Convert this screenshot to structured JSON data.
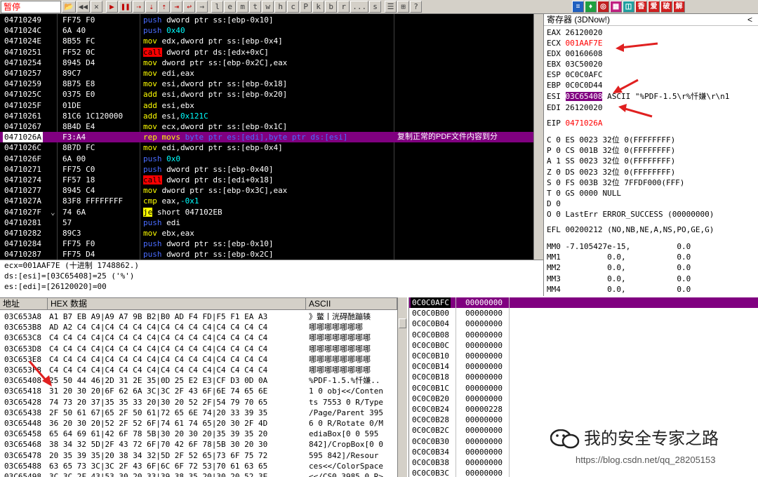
{
  "toolbar": {
    "status": "暂停",
    "buttons": [
      "📂",
      "◀◀",
      "✕",
      "▶",
      "❚❚",
      "⇢",
      "⇣",
      "⇡",
      "⇥",
      "↩",
      "→",
      "l",
      "e",
      "m",
      "t",
      "w",
      "h",
      "c",
      "P",
      "k",
      "b",
      "r",
      "...",
      "s",
      "☰",
      "⊞",
      "?"
    ],
    "right_buttons": [
      "≡",
      "♦",
      "◎",
      "▦",
      "◫",
      "香",
      "爱",
      "破",
      "解"
    ]
  },
  "cpu": {
    "rows": [
      {
        "addr": "04710249",
        "hex": "FF75 F0",
        "asm": [
          [
            "kw",
            "push "
          ],
          [
            "arg",
            "dword ptr ss:[ebp-0x10]"
          ]
        ],
        "cmt": ""
      },
      {
        "addr": "0471024C",
        "hex": "6A 40",
        "asm": [
          [
            "kw",
            "push "
          ],
          [
            "num",
            "0x40"
          ]
        ],
        "cmt": ""
      },
      {
        "addr": "0471024E",
        "hex": "8B55 FC",
        "asm": [
          [
            "mem",
            "mov "
          ],
          [
            "arg",
            "edx,dword ptr ss:[ebp-0x4]"
          ]
        ],
        "cmt": ""
      },
      {
        "addr": "04710251",
        "hex": "FF52 0C",
        "asm": [
          [
            "callhl",
            "call"
          ],
          [
            "arg",
            " dword ptr ds:[edx+0xC]"
          ]
        ],
        "cmt": ""
      },
      {
        "addr": "04710254",
        "hex": "8945 D4",
        "asm": [
          [
            "mem",
            "mov "
          ],
          [
            "arg",
            "dword ptr ss:[ebp-0x2C],eax"
          ]
        ],
        "cmt": ""
      },
      {
        "addr": "04710257",
        "hex": "89C7",
        "asm": [
          [
            "mem",
            "mov "
          ],
          [
            "arg",
            "edi,eax"
          ]
        ],
        "cmt": ""
      },
      {
        "addr": "04710259",
        "hex": "8B75 E8",
        "asm": [
          [
            "mem",
            "mov "
          ],
          [
            "arg",
            "esi,dword ptr ss:[ebp-0x18]"
          ]
        ],
        "cmt": ""
      },
      {
        "addr": "0471025C",
        "hex": "0375 E0",
        "asm": [
          [
            "mem",
            "add "
          ],
          [
            "arg",
            "esi,dword ptr ss:[ebp-0x20]"
          ]
        ],
        "cmt": ""
      },
      {
        "addr": "0471025F",
        "hex": "01DE",
        "asm": [
          [
            "mem",
            "add "
          ],
          [
            "arg",
            "esi,ebx"
          ]
        ],
        "cmt": ""
      },
      {
        "addr": "04710261",
        "hex": "81C6 1C120000",
        "asm": [
          [
            "mem",
            "add "
          ],
          [
            "arg",
            "esi,"
          ],
          [
            "num",
            "0x121C"
          ]
        ],
        "cmt": ""
      },
      {
        "addr": "04710267",
        "hex": "8B4D E4",
        "asm": [
          [
            "mem",
            "mov "
          ],
          [
            "arg",
            "ecx,dword ptr ss:[ebp-0x1C]"
          ]
        ],
        "cmt": ""
      },
      {
        "addr": "0471026A",
        "hex": "F3:A4",
        "asm": [
          [
            "mem",
            "rep movs "
          ],
          [
            "kw",
            "byte ptr es:[edi],byte ptr ds:[esi]"
          ]
        ],
        "cmt": "复制正常的PDF文件内容到分",
        "sel": true
      },
      {
        "addr": "0471026C",
        "hex": "8B7D FC",
        "asm": [
          [
            "mem",
            "mov "
          ],
          [
            "arg",
            "edi,dword ptr ss:[ebp-0x4]"
          ]
        ],
        "cmt": ""
      },
      {
        "addr": "0471026F",
        "hex": "6A 00",
        "asm": [
          [
            "kw",
            "push "
          ],
          [
            "num",
            "0x0"
          ]
        ],
        "cmt": ""
      },
      {
        "addr": "04710271",
        "hex": "FF75 C0",
        "asm": [
          [
            "kw",
            "push "
          ],
          [
            "arg",
            "dword ptr ss:[ebp-0x40]"
          ]
        ],
        "cmt": ""
      },
      {
        "addr": "04710274",
        "hex": "FF57 18",
        "asm": [
          [
            "callhl",
            "call"
          ],
          [
            "arg",
            " dword ptr ds:[edi+0x18]"
          ]
        ],
        "cmt": ""
      },
      {
        "addr": "04710277",
        "hex": "8945 C4",
        "asm": [
          [
            "mem",
            "mov "
          ],
          [
            "arg",
            "dword ptr ss:[ebp-0x3C],eax"
          ]
        ],
        "cmt": ""
      },
      {
        "addr": "0471027A",
        "hex": "83F8 FFFFFFFF",
        "asm": [
          [
            "mem",
            "cmp "
          ],
          [
            "arg",
            "eax,"
          ],
          [
            "num",
            "-0x1"
          ]
        ],
        "cmt": ""
      },
      {
        "addr": "0471027F",
        "hex": "74 6A",
        "asm": [
          [
            "jehl",
            "je"
          ],
          [
            "arg",
            " short 047102EB"
          ]
        ],
        "cmt": ""
      },
      {
        "addr": "04710281",
        "hex": "57",
        "asm": [
          [
            "kw",
            "push "
          ],
          [
            "arg",
            "edi"
          ]
        ],
        "cmt": ""
      },
      {
        "addr": "04710282",
        "hex": "89C3",
        "asm": [
          [
            "mem",
            "mov "
          ],
          [
            "arg",
            "ebx,eax"
          ]
        ],
        "cmt": ""
      },
      {
        "addr": "04710284",
        "hex": "FF75 F0",
        "asm": [
          [
            "kw",
            "push "
          ],
          [
            "arg",
            "dword ptr ss:[ebp-0x10]"
          ]
        ],
        "cmt": ""
      },
      {
        "addr": "04710287",
        "hex": "FF75 D4",
        "asm": [
          [
            "kw",
            "push "
          ],
          [
            "arg",
            "dword ptr ss:[ebp-0x2C]"
          ]
        ],
        "cmt": ""
      }
    ],
    "jump_marker": "⌄"
  },
  "info": {
    "line1": "ecx=001AAF7E (十进制 1748862.)",
    "line2": "ds:[esi]=[03C65408]=25 ('%')",
    "line3": "es:[edi]=[26120020]=00"
  },
  "regs": {
    "title": "寄存器 (3DNow!)",
    "collapse": "<",
    "eax": "EAX 26120020",
    "ecx_name": "ECX",
    "ecx_val": "001AAF7E",
    "edx": "EDX 00160608",
    "ebx": "EBX 03C50020",
    "esp": "ESP 0C0C0AFC",
    "ebp": "EBP 0C0C0D44",
    "esi_name": "ESI",
    "esi_val": "03C65408",
    "esi_cmt": "ASCII \"%PDF-1.5\\r%忏嫌\\r\\n1",
    "edi": "EDI 26120020",
    "eip_name": "EIP",
    "eip_val": "0471026A",
    "flags": [
      "C 0  ES 0023 32位 0(FFFFFFFF)",
      "P 0  CS 001B 32位 0(FFFFFFFF)",
      "A 1  SS 0023 32位 0(FFFFFFFF)",
      "Z 0  DS 0023 32位 0(FFFFFFFF)",
      "S 0  FS 003B 32位 7FFDF000(FFF)",
      "T 0  GS 0000 NULL",
      "D 0",
      "O 0  LastErr ERROR_SUCCESS (00000000)"
    ],
    "efl": "EFL 00200212 (NO,NB,NE,A,NS,PO,GE,G)",
    "mm": [
      "MM0 -7.105427e-15,          0.0",
      "MM1          0.0,           0.0",
      "MM2          0.0,           0.0",
      "MM3          0.0,           0.0",
      "MM4          0.0,           0.0"
    ]
  },
  "dump": {
    "hdr_addr": "地址",
    "hdr_hex": "HEX 数据",
    "hdr_ascii": "ASCII",
    "rows": [
      {
        "addr": "03C653A8",
        "hex": "A1 B7 EB A9|A9 A7 9B B2|B0 AD F4 FD|F5 F1 EA A3",
        "asc": "》鳖丨洸碍酏蹦辏"
      },
      {
        "addr": "03C653B8",
        "hex": "AD A2 C4 C4|C4 C4 C4 C4|C4 C4 C4 C4|C4 C4 C4 C4",
        "asc": "  哪哪哪哪哪哪哪"
      },
      {
        "addr": "03C653C8",
        "hex": "C4 C4 C4 C4|C4 C4 C4 C4|C4 C4 C4 C4|C4 C4 C4 C4",
        "asc": "哪哪哪哪哪哪哪哪"
      },
      {
        "addr": "03C653D8",
        "hex": "C4 C4 C4 C4|C4 C4 C4 C4|C4 C4 C4 C4|C4 C4 C4 C4",
        "asc": "哪哪哪哪哪哪哪哪"
      },
      {
        "addr": "03C653E8",
        "hex": "C4 C4 C4 C4|C4 C4 C4 C4|C4 C4 C4 C4|C4 C4 C4 C4",
        "asc": "哪哪哪哪哪哪哪哪"
      },
      {
        "addr": "03C653F8",
        "hex": "C4 C4 C4 C4|C4 C4 C4 C4|C4 C4 C4 C4|C4 C4 C4 C4",
        "asc": "哪哪哪哪哪哪哪哪"
      },
      {
        "addr": "03C65408",
        "hex": "25 50 44 46|2D 31 2E 35|0D 25 E2 E3|CF D3 0D 0A",
        "asc": "%PDF-1.5.%忏嫌.."
      },
      {
        "addr": "03C65418",
        "hex": "31 20 30 20|6F 62 6A 3C|3C 2F 43 6F|6E 74 65 6E",
        "asc": "1 0 obj<</Conten"
      },
      {
        "addr": "03C65428",
        "hex": "74 73 20 37|35 35 33 20|30 20 52 2F|54 79 70 65",
        "asc": "ts 7553 0 R/Type"
      },
      {
        "addr": "03C65438",
        "hex": "2F 50 61 67|65 2F 50 61|72 65 6E 74|20 33 39 35",
        "asc": "/Page/Parent 395"
      },
      {
        "addr": "03C65448",
        "hex": "36 20 30 20|52 2F 52 6F|74 61 74 65|20 30 2F 4D",
        "asc": "6 0 R/Rotate 0/M"
      },
      {
        "addr": "03C65458",
        "hex": "65 64 69 61|42 6F 78 5B|30 20 30 20|35 39 35 20",
        "asc": "ediaBox[0 0 595 "
      },
      {
        "addr": "03C65468",
        "hex": "38 34 32 5D|2F 43 72 6F|70 42 6F 78|5B 30 20 30",
        "asc": "842]/CropBox[0 0"
      },
      {
        "addr": "03C65478",
        "hex": "20 35 39 35|20 38 34 32|5D 2F 52 65|73 6F 75 72",
        "asc": " 595 842]/Resour"
      },
      {
        "addr": "03C65488",
        "hex": "63 65 73 3C|3C 2F 43 6F|6C 6F 72 53|70 61 63 65",
        "asc": "ces<</ColorSpace"
      },
      {
        "addr": "03C65498",
        "hex": "3C 3C 2F 43|53 30 20 33|39 38 35 20|30 20 52 3E",
        "asc": "<</CS0 3985 0 R>"
      }
    ]
  },
  "stack": {
    "rows": [
      {
        "addr": "0C0C0AFC",
        "val": "00000000",
        "sel": true
      },
      {
        "addr": "0C0C0B00",
        "val": "00000000"
      },
      {
        "addr": "0C0C0B04",
        "val": "00000000"
      },
      {
        "addr": "0C0C0B08",
        "val": "00000000"
      },
      {
        "addr": "0C0C0B0C",
        "val": "00000000"
      },
      {
        "addr": "0C0C0B10",
        "val": "00000000"
      },
      {
        "addr": "0C0C0B14",
        "val": "00000000"
      },
      {
        "addr": "0C0C0B18",
        "val": "00000000"
      },
      {
        "addr": "0C0C0B1C",
        "val": "00000000"
      },
      {
        "addr": "0C0C0B20",
        "val": "00000000"
      },
      {
        "addr": "0C0C0B24",
        "val": "00000228"
      },
      {
        "addr": "0C0C0B28",
        "val": "00000000"
      },
      {
        "addr": "0C0C0B2C",
        "val": "00000000"
      },
      {
        "addr": "0C0C0B30",
        "val": "00000000"
      },
      {
        "addr": "0C0C0B34",
        "val": "00000000"
      },
      {
        "addr": "0C0C0B38",
        "val": "00000000"
      },
      {
        "addr": "0C0C0B3C",
        "val": "00000000"
      }
    ]
  },
  "watermark": {
    "title": "我的安全专家之路",
    "url": "https://blog.csdn.net/qq_28205153"
  },
  "colors": {
    "accent_red": "#ff0000",
    "selection": "#800080",
    "code_bg": "#000000",
    "mnemonic": "#ffff00",
    "push": "#0000ff",
    "number": "#00ffff"
  }
}
